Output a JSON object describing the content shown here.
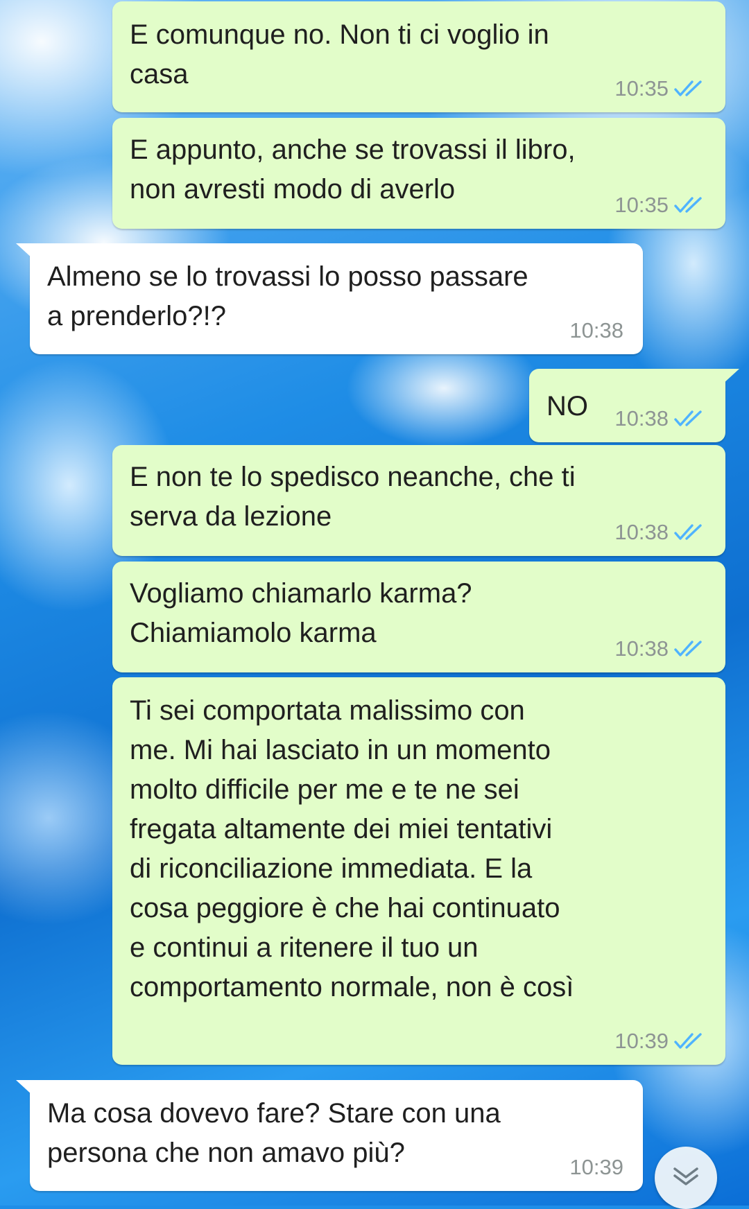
{
  "colors": {
    "outgoing_bubble": "#e2fdc9",
    "incoming_bubble": "#ffffff",
    "read_tick": "#4fb3ff",
    "timestamp": "#8d9493"
  },
  "messages": [
    {
      "direction": "outgoing",
      "text": "E comunque no. Non ti ci voglio in\ncasa",
      "time": "10:35",
      "status": "read-ticks-icon"
    },
    {
      "direction": "outgoing",
      "text": "E appunto, anche se trovassi il libro,\nnon avresti modo di averlo",
      "time": "10:35",
      "status": "read-ticks-icon"
    },
    {
      "direction": "incoming",
      "text": "Almeno se lo trovassi lo posso passare\na prenderlo?!?",
      "time": "10:38"
    },
    {
      "direction": "outgoing",
      "text": "NO",
      "time": "10:38",
      "status": "read-ticks-icon"
    },
    {
      "direction": "outgoing",
      "text": "E non te lo spedisco neanche, che ti\nserva da lezione",
      "time": "10:38",
      "status": "read-ticks-icon"
    },
    {
      "direction": "outgoing",
      "text": "Vogliamo chiamarlo karma?\nChiamiamolo karma",
      "time": "10:38",
      "status": "read-ticks-icon"
    },
    {
      "direction": "outgoing",
      "text": "Ti sei comportata malissimo con\nme. Mi hai lasciato in un momento\nmolto difficile per me e te ne sei\nfregata altamente dei miei tentativi\ndi riconciliazione immediata. E la\ncosa peggiore è che hai continuato\ne continui a ritenere il tuo un\ncomportamento normale, non è così",
      "time": "10:39",
      "status": "read-ticks-icon"
    },
    {
      "direction": "incoming",
      "text": "Ma cosa dovevo fare? Stare con una\npersona che non amavo più?",
      "time": "10:39"
    }
  ],
  "scroll_button": {
    "icon": "double-chevron-down-icon"
  }
}
